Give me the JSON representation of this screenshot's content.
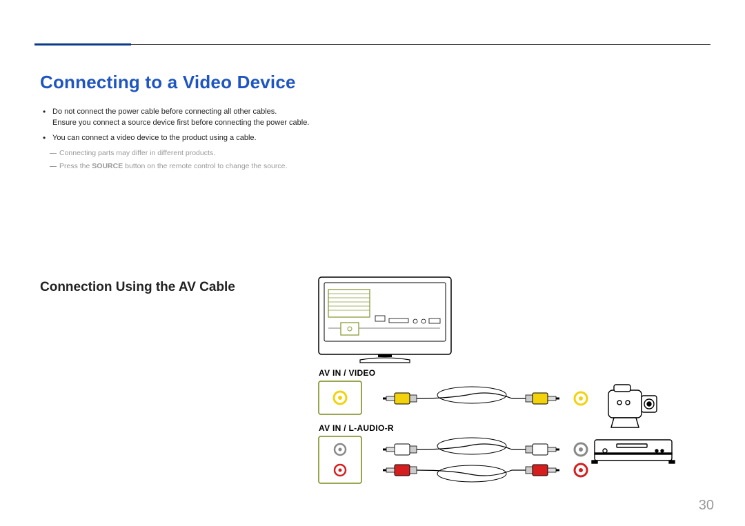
{
  "header": {},
  "main": {
    "title": "Connecting to a Video Device",
    "bullets": [
      {
        "line1": "Do not connect the power cable before connecting all other cables.",
        "line2": "Ensure you connect a source device first before connecting the power cable."
      },
      {
        "line1": "You can connect a video device to the product using a cable."
      }
    ],
    "notes": [
      "Connecting parts may differ in different products.",
      "Press the SOURCE button on the remote control to change the source."
    ],
    "section_title": "Connection Using the AV Cable",
    "port_labels": {
      "video": "AV IN / VIDEO",
      "audio": "AV IN / L-AUDIO-R"
    }
  },
  "page_number": "30",
  "colors": {
    "heading_blue": "#1f55c0",
    "dark_navy": "#0a3a8a",
    "port_box_stroke": "#8a9a3a",
    "yellow": "#f2d20c",
    "red": "#d61e1e",
    "red_outline": "#d61e1e",
    "white_plug": "#ffffff",
    "gray_note": "#999999"
  },
  "diagram": {
    "items": [
      {
        "name": "tv-back-panel"
      },
      {
        "name": "video-port-box",
        "jacks": [
          "yellow"
        ]
      },
      {
        "name": "audio-port-box",
        "jacks": [
          "white",
          "red"
        ]
      },
      {
        "name": "cable-video-yellow"
      },
      {
        "name": "cable-audio-white"
      },
      {
        "name": "cable-audio-red"
      },
      {
        "name": "camcorder-device"
      },
      {
        "name": "dvd-player-device"
      },
      {
        "name": "device-jack-yellow"
      },
      {
        "name": "device-jack-white"
      },
      {
        "name": "device-jack-red"
      }
    ]
  }
}
